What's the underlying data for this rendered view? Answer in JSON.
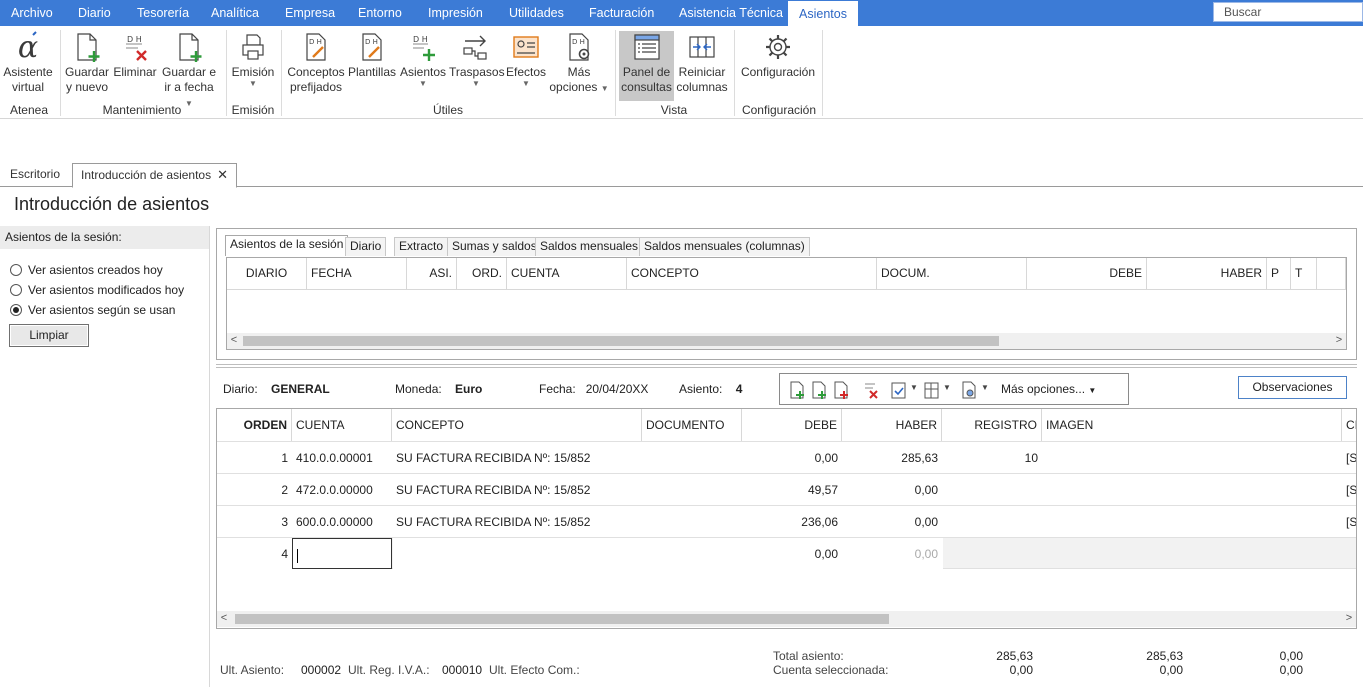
{
  "menu": {
    "items": [
      "Archivo",
      "Diario",
      "Tesorería",
      "Analítica",
      "Empresa",
      "Entorno",
      "Impresión",
      "Utilidades",
      "Facturación",
      "Asistencia Técnica",
      "Asientos"
    ],
    "search_placeholder": "Buscar"
  },
  "ribbon": {
    "asistente": [
      "Asistente",
      "virtual"
    ],
    "guardar_nuevo": [
      "Guardar",
      "y nuevo"
    ],
    "eliminar": [
      "Eliminar"
    ],
    "guardar_fecha": [
      "Guardar e",
      "ir a fecha"
    ],
    "emision": [
      "Emisión"
    ],
    "conceptos": [
      "Conceptos",
      "prefijados"
    ],
    "plantillas": [
      "Plantillas"
    ],
    "asientos": [
      "Asientos"
    ],
    "traspasos": [
      "Traspasos"
    ],
    "efectos": [
      "Efectos"
    ],
    "mas_opciones": [
      "Más",
      "opciones"
    ],
    "panel": [
      "Panel de",
      "consultas"
    ],
    "reiniciar": [
      "Reiniciar",
      "columnas"
    ],
    "configuracion": [
      "Configuración"
    ],
    "groups": {
      "atenea": "Atenea",
      "mantenimiento": "Mantenimiento",
      "emision": "Emisión",
      "utiles": "Útiles",
      "vista": "Vista",
      "configuracion": "Configuración"
    }
  },
  "doc_tabs": {
    "escritorio": "Escritorio",
    "introduccion": "Introducción de asientos",
    "close": "✕"
  },
  "page_title": "Introducción de asientos",
  "left": {
    "header": "Asientos de la sesión:",
    "options": [
      "Ver asientos creados hoy",
      "Ver asientos modificados hoy",
      "Ver asientos según se usan"
    ],
    "selected_index": 2,
    "button": "Limpiar"
  },
  "session_tabs": [
    "Asientos de la sesión",
    "Diario",
    "Extracto",
    "Sumas y saldos",
    "Saldos mensuales",
    "Saldos mensuales (columnas)"
  ],
  "session_columns": [
    "DIARIO",
    "FECHA",
    "ASI.",
    "ORD.",
    "CUENTA",
    "CONCEPTO",
    "DOCUM.",
    "DEBE",
    "HABER",
    "P",
    "T"
  ],
  "entry": {
    "diario_label": "Diario:",
    "diario_value": "GENERAL",
    "moneda_label": "Moneda:",
    "moneda_value": "Euro",
    "fecha_label": "Fecha:",
    "fecha_value": "20/04/20XX",
    "asiento_label": "Asiento:",
    "asiento_value": "4",
    "mas_opciones": "Más opciones...",
    "observaciones": "Observaciones"
  },
  "grid": {
    "columns": [
      "ORDEN",
      "CUENTA",
      "CONCEPTO",
      "DOCUMENTO",
      "DEBE",
      "HABER",
      "REGISTRO",
      "IMAGEN",
      "CI"
    ],
    "rows": [
      {
        "orden": "1",
        "cuenta": "410.0.0.00001",
        "concepto": "SU FACTURA RECIBIDA Nº:  15/852",
        "debe": "0,00",
        "haber": "285,63",
        "registro": "10",
        "extra": "[S"
      },
      {
        "orden": "2",
        "cuenta": "472.0.0.00000",
        "concepto": "SU FACTURA RECIBIDA Nº:  15/852",
        "debe": "49,57",
        "haber": "0,00",
        "registro": "",
        "extra": "[S"
      },
      {
        "orden": "3",
        "cuenta": "600.0.0.00000",
        "concepto": "SU FACTURA RECIBIDA Nº:  15/852",
        "debe": "236,06",
        "haber": "0,00",
        "registro": "",
        "extra": "[S"
      },
      {
        "orden": "4",
        "cuenta": "",
        "concepto": "",
        "debe": "0,00",
        "haber": "0,00",
        "registro": "",
        "extra": ""
      }
    ]
  },
  "footer": {
    "ult_asiento_label": "Ult. Asiento:",
    "ult_asiento_value": "000002",
    "ult_reg_label": "Ult. Reg. I.V.A.:",
    "ult_reg_value": "000010",
    "ult_efecto_label": "Ult. Efecto Com.:",
    "total_label": "Total asiento:",
    "total_debe": "285,63",
    "total_haber": "285,63",
    "total_saldo": "0,00",
    "cuenta_label": "Cuenta seleccionada:",
    "cuenta_debe": "0,00",
    "cuenta_haber": "0,00",
    "cuenta_saldo": "0,00"
  },
  "colors": {
    "menubar": "#3c7bd6",
    "accent": "#2c66c4",
    "icon_green": "#2e9b3a",
    "icon_red": "#d12a2a"
  }
}
